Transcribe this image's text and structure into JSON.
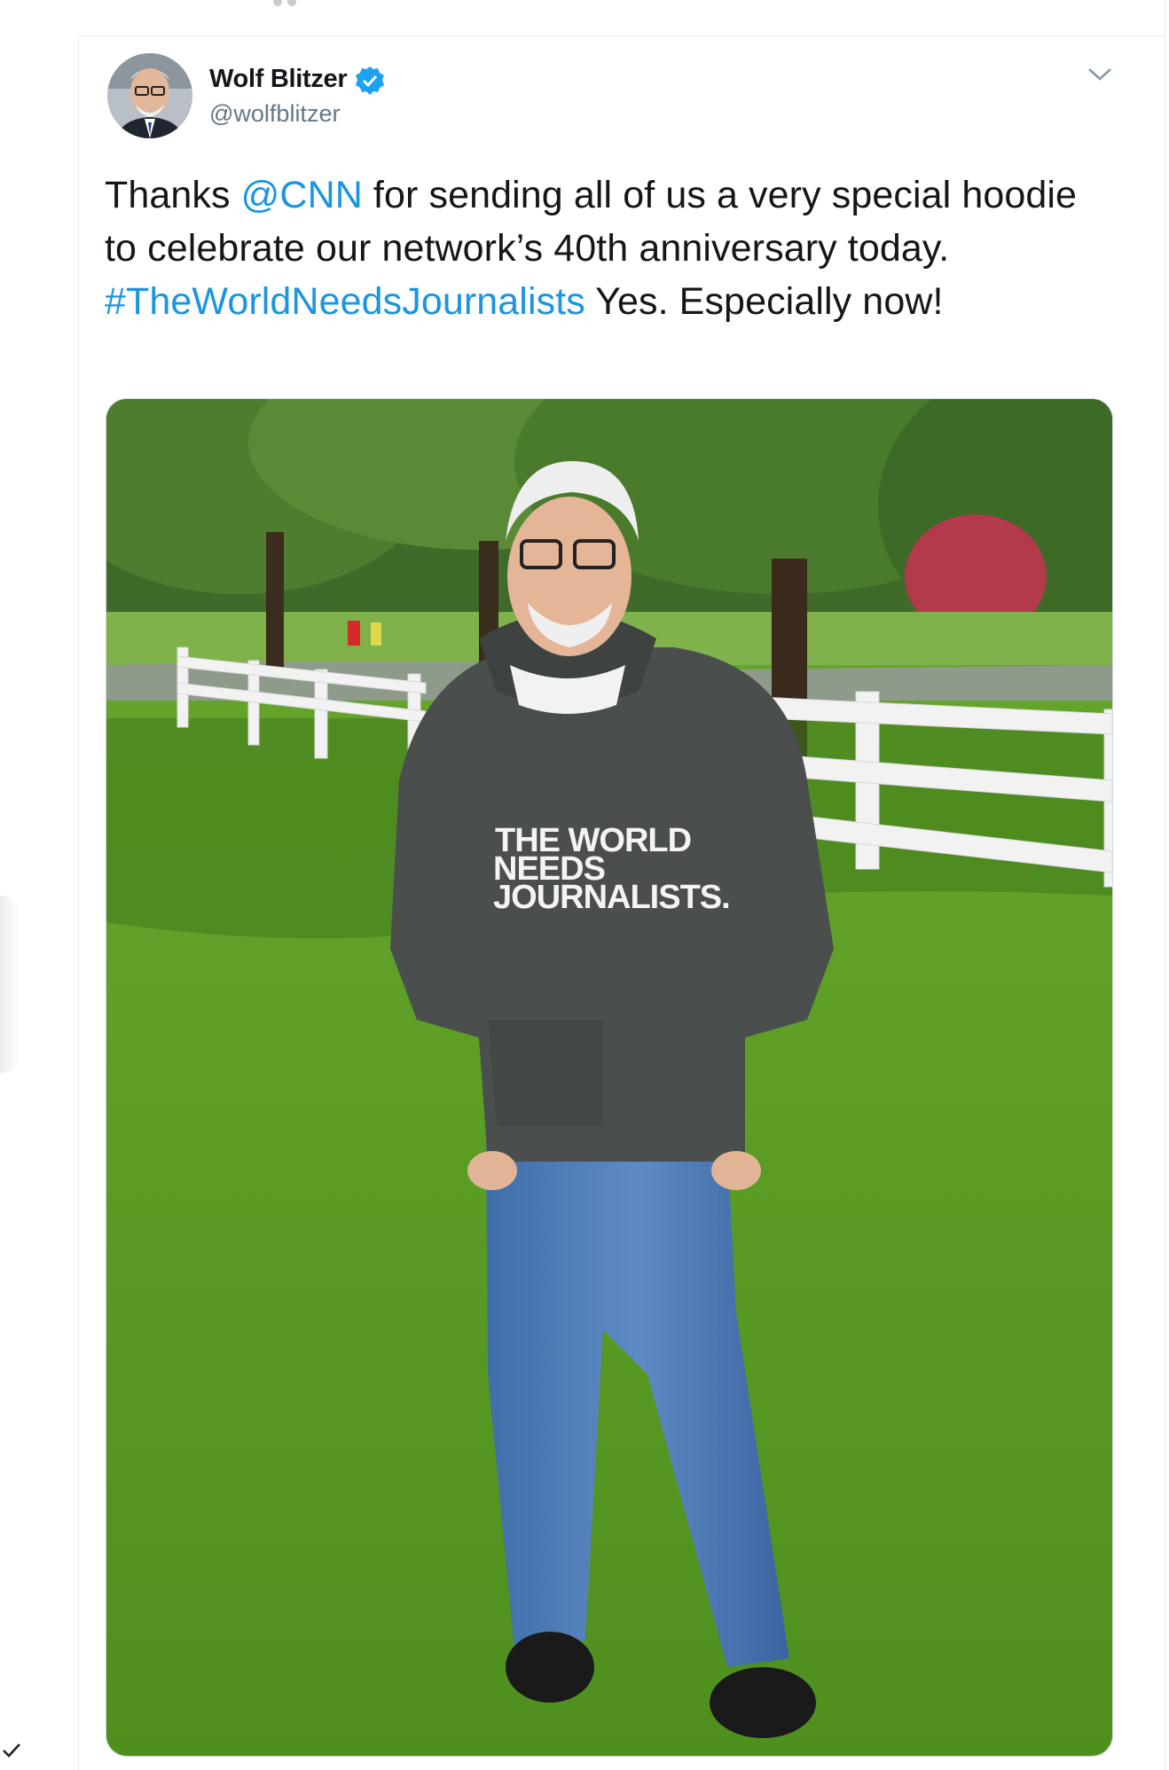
{
  "tweet": {
    "author_name": "Wolf Blitzer",
    "handle": "@wolfblitzer",
    "text_parts": {
      "p1": "Thanks ",
      "mention": "@CNN",
      "p2": " for sending all of us a very special hoodie to celebrate our network’s 40th anniversary today. ",
      "hashtag": "#TheWorldNeedsJournalists",
      "p3": " Yes. Especially now!"
    },
    "photo": {
      "hoodie_line1": "THE WORLD",
      "hoodie_line2": "NEEDS",
      "hoodie_line3": "JOURNALISTS."
    }
  },
  "colors": {
    "link": "#1b95e0",
    "text": "#14171a",
    "secondary": "#657786",
    "verified": "#1da1f2"
  },
  "icons": {
    "verified": "verified-badge-icon",
    "more": "chevron-down-icon",
    "left_edge": "checkmark-icon"
  }
}
